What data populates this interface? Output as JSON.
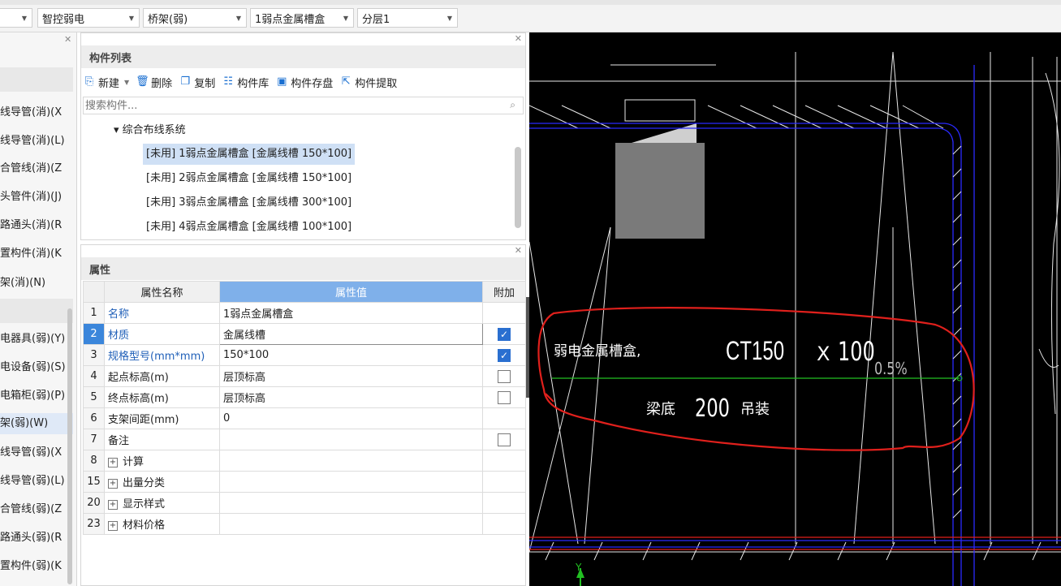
{
  "toolbar": {
    "combo1_label": "智控弱电",
    "combo2_label": "桥架(弱)",
    "combo3_label": "1弱点金属槽盒",
    "combo4_label": "分层1"
  },
  "left_strip": {
    "items": [
      "线导管(消)(X",
      "线导管(消)(L)",
      "合管线(消)(Z",
      "头管件(消)(J)",
      "路通头(消)(R",
      "置构件(消)(K",
      "架(消)(N)",
      "电器具(弱)(Y)",
      "电设备(弱)(S)",
      "电箱柜(弱)(P)",
      "架(弱)(W)",
      "线导管(弱)(X",
      "线导管(弱)(L)",
      "合管线(弱)(Z",
      "路通头(弱)(R",
      "置构件(弱)(K"
    ]
  },
  "component_list": {
    "title": "构件列表",
    "toolbar": {
      "new_label": "新建",
      "delete_label": "删除",
      "copy_label": "复制",
      "library_label": "构件库",
      "save_label": "构件存盘",
      "extract_label": "构件提取"
    },
    "search_placeholder": "搜索构件...",
    "group_label": "▾ 综合布线系统",
    "items": [
      "[未用] 1弱点金属槽盒 [金属线槽 150*100]",
      "[未用] 2弱点金属槽盒 [金属线槽 150*100]",
      "[未用] 3弱点金属槽盒 [金属线槽 300*100]",
      "[未用] 4弱点金属槽盒 [金属线槽 100*100]"
    ]
  },
  "properties": {
    "title": "属性",
    "headers": {
      "name": "属性名称",
      "value": "属性值",
      "extra": "附加"
    },
    "rows": [
      {
        "num": "1",
        "name": "名称",
        "value": "1弱点金属槽盒",
        "checked": null
      },
      {
        "num": "2",
        "name": "材质",
        "value": "金属线槽",
        "checked": true
      },
      {
        "num": "3",
        "name": "规格型号(mm*mm)",
        "value": "150*100",
        "checked": true
      },
      {
        "num": "4",
        "name": "起点标高(m)",
        "value": "层顶标高",
        "checked": false
      },
      {
        "num": "5",
        "name": "终点标高(m)",
        "value": "层顶标高",
        "checked": false
      },
      {
        "num": "6",
        "name": "支架间距(mm)",
        "value": "0",
        "checked": null
      },
      {
        "num": "7",
        "name": "备注",
        "value": "",
        "checked": false
      },
      {
        "num": "8",
        "name": "计算",
        "value": "",
        "checked": null
      },
      {
        "num": "15",
        "name": "出量分类",
        "value": "",
        "checked": null
      },
      {
        "num": "20",
        "name": "显示样式",
        "value": "",
        "checked": null
      },
      {
        "num": "23",
        "name": "材料价格",
        "value": "",
        "checked": null
      }
    ]
  },
  "cad": {
    "label_main": "弱电金属槽盒,",
    "label_ct": "CT150",
    "label_x": "X",
    "label_100": "100",
    "label_slope": "0.5%",
    "label_beam": "梁底",
    "label_200": "200",
    "label_hang": "吊装",
    "axis_y": "Y"
  },
  "colors": {
    "highlight_header": "#7fb0ea",
    "selected_row": "#3b86db",
    "annotation_red": "#e0201c",
    "cad_blue": "#2a2aff",
    "cad_green": "#22c022"
  }
}
